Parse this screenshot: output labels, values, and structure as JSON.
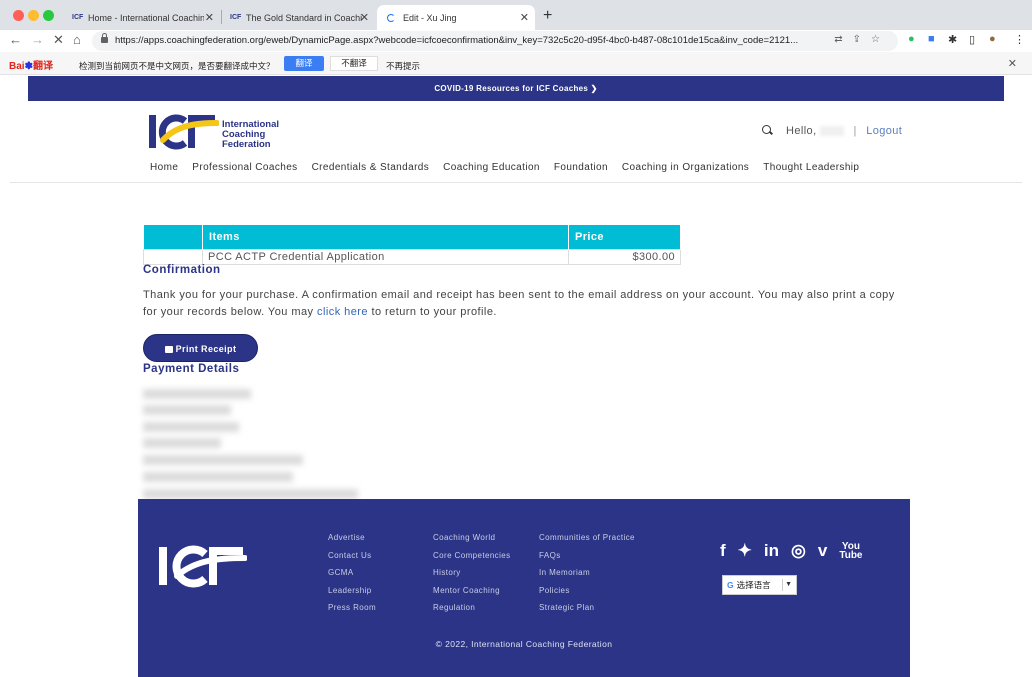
{
  "browser": {
    "tabs": [
      {
        "label": "Home - International Coaching",
        "favicon": "ICF"
      },
      {
        "label": "The Gold Standard in Coaching",
        "favicon": "ICF"
      },
      {
        "label": "Edit - Xu Jing",
        "favicon": ""
      }
    ],
    "url": "https://apps.coachingfederation.org/eweb/DynamicPage.aspx?webcode=icfcoeconfirmation&inv_key=732c5c20-d95f-4bc0-b487-08c101de15ca&inv_code=2121..."
  },
  "translate_bar": {
    "logo": "Bai",
    "logo_suffix": "翻译",
    "message": "检测到当前网页不是中文网页，是否要翻译成中文？",
    "translate_button": "翻译",
    "no_translate_button": "不翻译",
    "never_button": "不再提示"
  },
  "banner": {
    "text": "COVID-19 Resources for ICF Coaches ❯"
  },
  "header": {
    "logo_line1": "International",
    "logo_line2": "Coaching",
    "logo_line3": "Federation",
    "hello": "Hello,",
    "logout": "Logout"
  },
  "nav": [
    "Home",
    "Professional Coaches",
    "Credentials & Standards",
    "Coaching Education",
    "Foundation",
    "Coaching in Organizations",
    "Thought Leadership"
  ],
  "order_table": {
    "headers": [
      "",
      "Items",
      "Price"
    ],
    "rows": [
      [
        "",
        "PCC ACTP Credential Application",
        "$300.00"
      ]
    ]
  },
  "confirmation": {
    "heading": "Confirmation",
    "text_before": "Thank you for your purchase. A confirmation email and receipt has been sent to the email address on your account. You may also print a copy for your records below. You may ",
    "link": "click here",
    "text_after": " to return to your profile."
  },
  "print_button": "Print Receipt",
  "payment_heading": "Payment Details",
  "footer": {
    "col1": [
      "Advertise",
      "Contact Us",
      "GCMA",
      "Leadership",
      "Press Room"
    ],
    "col2": [
      "Coaching World",
      "Core Competencies",
      "History",
      "Mentor Coaching",
      "Regulation"
    ],
    "col3": [
      "Communities of Practice",
      "FAQs",
      "In Memoriam",
      "Policies",
      "Strategic Plan"
    ],
    "language_select": "选择语言",
    "copyright": "© 2022, International Coaching Federation"
  },
  "colors": {
    "brand_navy": "#2b3486",
    "accent_teal": "#00bcd4",
    "link_blue": "#3165b6",
    "logo_yellow": "#f5c518"
  }
}
